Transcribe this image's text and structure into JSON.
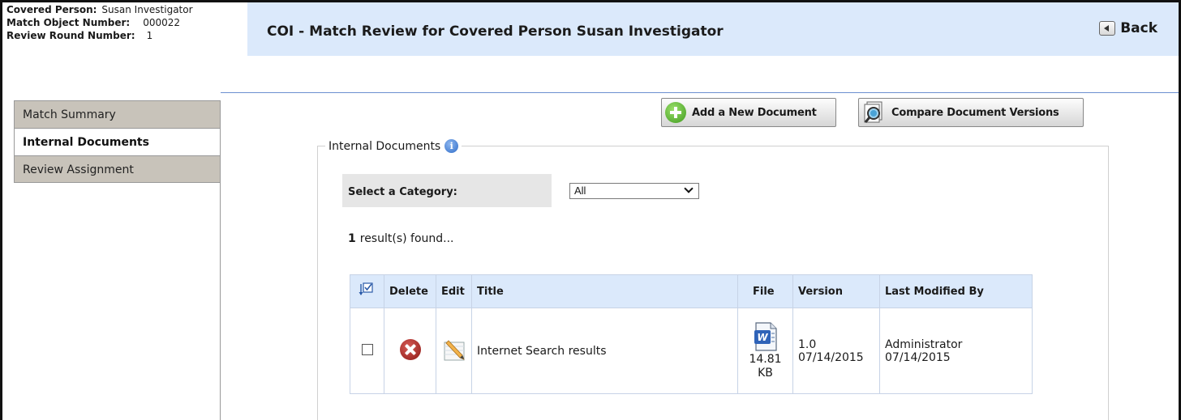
{
  "info": {
    "covered_person_label": "Covered Person:",
    "covered_person_value": "Susan Investigator",
    "match_object_label": "Match Object Number:",
    "match_object_value": "000022",
    "review_round_label": "Review Round Number:",
    "review_round_value": "1"
  },
  "header": {
    "title": "COI - Match Review for Covered Person Susan Investigator",
    "back_label": "Back"
  },
  "sidebar": {
    "items": [
      {
        "label": "Match Summary",
        "active": false
      },
      {
        "label": "Internal Documents",
        "active": true
      },
      {
        "label": "Review Assignment",
        "active": false
      }
    ]
  },
  "actions": {
    "add_label": "Add a New Document",
    "compare_label": "Compare Document Versions"
  },
  "section": {
    "legend": "Internal Documents",
    "category_label": "Select a Category:",
    "category_value": "All",
    "result_count": "1",
    "result_text": "result(s) found..."
  },
  "table": {
    "columns": [
      "Delete",
      "Edit",
      "Title",
      "File",
      "Version",
      "Last Modified By"
    ],
    "rows": [
      {
        "title": "Internet Search results",
        "file_size": "14.81",
        "file_unit": "KB",
        "version": "1.0",
        "version_date": "07/14/2015",
        "modified_by": "Administrator",
        "modified_date": "07/14/2015"
      }
    ]
  },
  "colors": {
    "header_bg": "#dbe9fb",
    "tab_inactive_bg": "#c8c3ba",
    "delete_red": "#8e1a16",
    "add_green": "#3f9a1f"
  },
  "icons": {
    "back": "back-arrow-icon",
    "add": "plus-circle-icon",
    "compare": "magnifier-document-icon",
    "info": "info-icon",
    "select_all": "select-all-checkbox-icon",
    "delete": "delete-x-icon",
    "edit": "edit-pencil-icon",
    "file": "word-document-icon"
  }
}
